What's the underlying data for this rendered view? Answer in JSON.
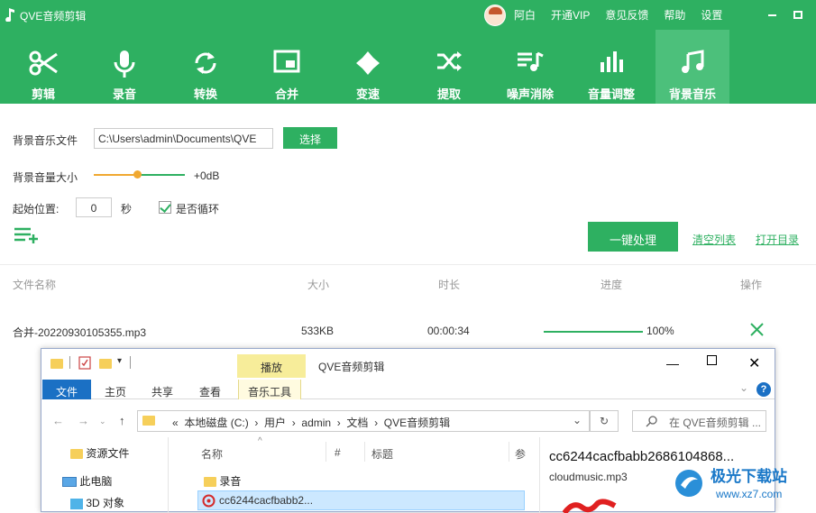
{
  "app": {
    "title": "QVE音频剪辑"
  },
  "titlebar": {
    "username": "阿白",
    "links": [
      "开通VIP",
      "意见反馈",
      "帮助",
      "设置"
    ]
  },
  "tools": [
    {
      "label": "剪辑",
      "icon": "scissors-icon"
    },
    {
      "label": "录音",
      "icon": "microphone-icon"
    },
    {
      "label": "转换",
      "icon": "convert-icon"
    },
    {
      "label": "合并",
      "icon": "merge-icon"
    },
    {
      "label": "变速",
      "icon": "speed-icon"
    },
    {
      "label": "提取",
      "icon": "extract-icon"
    },
    {
      "label": "噪声消除",
      "icon": "noise-icon"
    },
    {
      "label": "音量调整",
      "icon": "volume-bars-icon"
    },
    {
      "label": "背景音乐",
      "icon": "music-note-icon",
      "active": true
    }
  ],
  "settings": {
    "bg_music_label": "背景音乐文件",
    "bg_music_path": "C:\\Users\\admin\\Documents\\QVE",
    "select_button": "选择",
    "volume_label": "背景音量大小",
    "volume_value": "+0dB",
    "volume_level": 0.48,
    "start_label": "起始位置:",
    "start_value": "0",
    "start_unit": "秒",
    "loop_label": "是否循环",
    "loop_checked": true
  },
  "actions": {
    "process": "一键处理",
    "clear_list": "清空列表",
    "open_dir": "打开目录"
  },
  "table": {
    "headers": [
      "文件名称",
      "大小",
      "时长",
      "进度",
      "操作"
    ],
    "rows": [
      {
        "name": "合并-20220930105355.mp3",
        "size": "533KB",
        "duration": "00:00:34",
        "progress": "100%",
        "progress_value": 1.0
      }
    ]
  },
  "explorer": {
    "ctx_tab": "播放",
    "window_name": "QVE音频剪辑",
    "ribbon_tabs": [
      "文件",
      "主页",
      "共享",
      "查看"
    ],
    "music_tools": "音乐工具",
    "address_parts": [
      "«",
      "本地磁盘 (C:)",
      "›",
      "用户",
      "›",
      "admin",
      "›",
      "文档",
      "›",
      "QVE音频剪辑"
    ],
    "search_placeholder": "在 QVE音频剪辑 ...",
    "tree": [
      "资源文件",
      "此电脑",
      "3D 对象"
    ],
    "columns": [
      "名称",
      "#",
      "标题",
      "参"
    ],
    "files": [
      "录音",
      "cc6244cacfbabb2..."
    ],
    "preview_title": "cc6244cacfbabb2686104868...",
    "preview_sub": "cloudmusic.mp3"
  },
  "colors": {
    "brand": "#2eb061",
    "active_tab": "#4cc07b",
    "slider": "#f0a830"
  }
}
